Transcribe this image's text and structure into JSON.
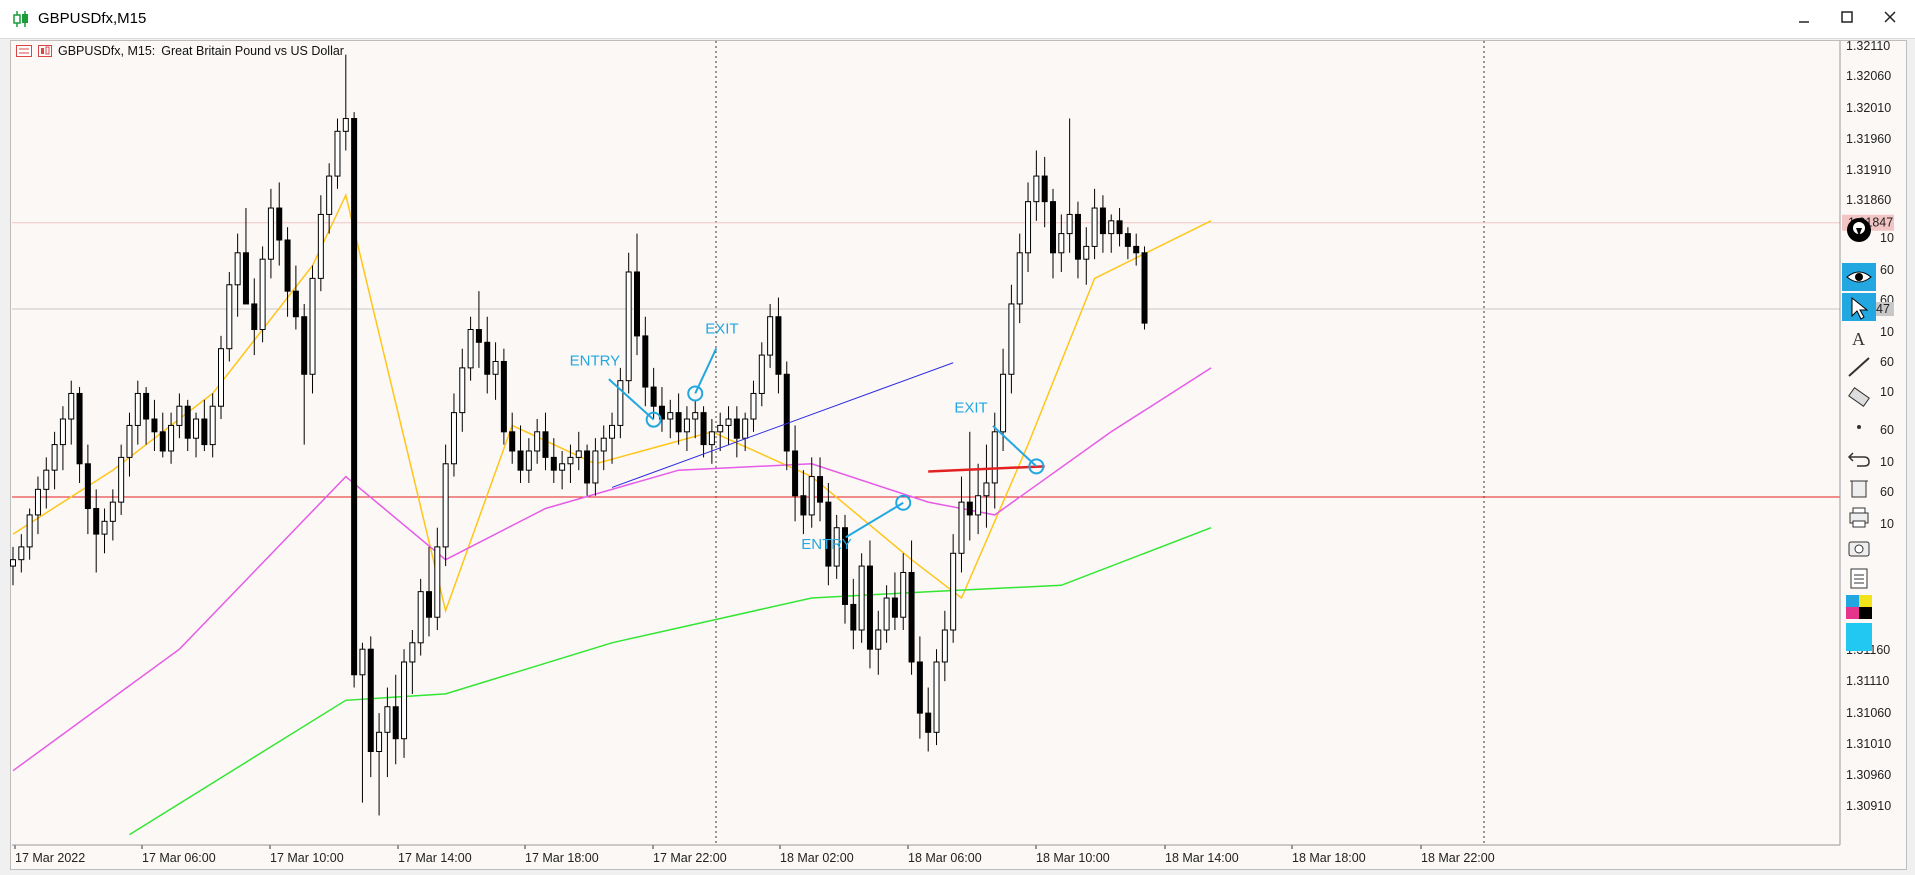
{
  "window": {
    "title": "GBPUSDfx,M15"
  },
  "header": {
    "symbol": "GBPUSDfx, M15:",
    "description": "Great Britain Pound vs US Dollar"
  },
  "colors": {
    "background": "#fbf8f6",
    "candle": "#000000",
    "ma_fast": "#ffc61a",
    "ma_mid": "#e65ce6",
    "ma_slow": "#33e633",
    "trendline": "#2d2de0",
    "level_line": "#e22222",
    "annotation": "#22a7e0"
  },
  "y_axis": {
    "labels": [
      "1.32110",
      "1.32060",
      "1.32010",
      "1.31960",
      "1.31910",
      "1.31860",
      "1.31160",
      "1.31110",
      "1.31060",
      "1.31010",
      "1.30960",
      "1.30910"
    ],
    "covered_labels": [
      "10",
      "60",
      "60",
      "10",
      "60",
      "10",
      "60",
      "10",
      "60",
      "10"
    ],
    "current_price_tag": "1.31847",
    "bid_tag": "47"
  },
  "x_axis": {
    "labels": [
      "17 Mar 2022",
      "17 Mar 06:00",
      "17 Mar 10:00",
      "17 Mar 14:00",
      "17 Mar 18:00",
      "17 Mar 22:00",
      "18 Mar 02:00",
      "18 Mar 06:00",
      "18 Mar 10:00",
      "18 Mar 14:00",
      "18 Mar 18:00",
      "18 Mar 22:00"
    ]
  },
  "annotations": {
    "entry1": "ENTRY",
    "exit1": "EXIT",
    "entry2": "ENTRY",
    "exit2": "EXIT"
  },
  "toolbar": {
    "tools": [
      "pin-tool",
      "eye-tool",
      "cursor-tool",
      "text-tool",
      "line-tool",
      "ruler-tool",
      "dot-tool",
      "undo-tool",
      "delete-tool",
      "print-tool",
      "screenshot-tool",
      "clipboard-tool",
      "color-tool",
      "color-swatch"
    ]
  },
  "chart_data": {
    "type": "candlestick",
    "symbol": "GBPUSDfx",
    "timeframe": "M15",
    "y_range": [
      1.3088,
      1.32125
    ],
    "candles": [
      [
        1.3131,
        1.3134,
        1.3128,
        1.3132
      ],
      [
        1.3132,
        1.3136,
        1.313,
        1.3134
      ],
      [
        1.3134,
        1.314,
        1.3132,
        1.3139
      ],
      [
        1.3139,
        1.3145,
        1.3136,
        1.3143
      ],
      [
        1.3143,
        1.3148,
        1.314,
        1.3146
      ],
      [
        1.3146,
        1.3152,
        1.3143,
        1.315
      ],
      [
        1.315,
        1.3156,
        1.3146,
        1.3154
      ],
      [
        1.3154,
        1.316,
        1.315,
        1.3158
      ],
      [
        1.3158,
        1.3159,
        1.3144,
        1.3147
      ],
      [
        1.3147,
        1.315,
        1.3136,
        1.314
      ],
      [
        1.314,
        1.3143,
        1.313,
        1.3136
      ],
      [
        1.3136,
        1.314,
        1.3133,
        1.3138
      ],
      [
        1.3138,
        1.3143,
        1.3135,
        1.3141
      ],
      [
        1.3141,
        1.315,
        1.3139,
        1.3148
      ],
      [
        1.3148,
        1.3155,
        1.3145,
        1.3153
      ],
      [
        1.3153,
        1.316,
        1.315,
        1.3158
      ],
      [
        1.3158,
        1.3159,
        1.315,
        1.3154
      ],
      [
        1.3154,
        1.3157,
        1.3149,
        1.3152
      ],
      [
        1.3152,
        1.3155,
        1.3148,
        1.3149
      ],
      [
        1.3149,
        1.3155,
        1.3147,
        1.3153
      ],
      [
        1.3153,
        1.3158,
        1.3151,
        1.3156
      ],
      [
        1.3156,
        1.3157,
        1.3149,
        1.3151
      ],
      [
        1.3151,
        1.3155,
        1.3148,
        1.3154
      ],
      [
        1.3154,
        1.3157,
        1.3149,
        1.315
      ],
      [
        1.315,
        1.3158,
        1.3148,
        1.3156
      ],
      [
        1.3156,
        1.3167,
        1.3154,
        1.3165
      ],
      [
        1.3165,
        1.3177,
        1.3163,
        1.3175
      ],
      [
        1.3175,
        1.3183,
        1.317,
        1.318
      ],
      [
        1.318,
        1.3187,
        1.3176,
        1.3172
      ],
      [
        1.3172,
        1.3176,
        1.3164,
        1.3168
      ],
      [
        1.3168,
        1.3181,
        1.3166,
        1.3179
      ],
      [
        1.3179,
        1.319,
        1.3176,
        1.3187
      ],
      [
        1.3187,
        1.3191,
        1.3178,
        1.3182
      ],
      [
        1.3182,
        1.3184,
        1.317,
        1.3174
      ],
      [
        1.3174,
        1.3178,
        1.3168,
        1.317
      ],
      [
        1.317,
        1.3172,
        1.315,
        1.3161
      ],
      [
        1.3161,
        1.3178,
        1.3158,
        1.3176
      ],
      [
        1.3176,
        1.3189,
        1.3174,
        1.3186
      ],
      [
        1.3186,
        1.3194,
        1.3183,
        1.3192
      ],
      [
        1.3192,
        1.3201,
        1.319,
        1.3199
      ],
      [
        1.3199,
        1.3211,
        1.3196,
        1.3201
      ],
      [
        1.3201,
        1.3202,
        1.3112,
        1.3114
      ],
      [
        1.3114,
        1.3119,
        1.3094,
        1.3118
      ],
      [
        1.3118,
        1.312,
        1.3098,
        1.3102
      ],
      [
        1.3102,
        1.3108,
        1.3092,
        1.3105
      ],
      [
        1.3105,
        1.3112,
        1.3098,
        1.3109
      ],
      [
        1.3109,
        1.3114,
        1.31,
        1.3104
      ],
      [
        1.3104,
        1.3118,
        1.3101,
        1.3116
      ],
      [
        1.3116,
        1.3121,
        1.3111,
        1.3119
      ],
      [
        1.3119,
        1.3129,
        1.3117,
        1.3127
      ],
      [
        1.3127,
        1.3134,
        1.312,
        1.3123
      ],
      [
        1.3123,
        1.3137,
        1.3121,
        1.3134
      ],
      [
        1.3134,
        1.315,
        1.3131,
        1.3147
      ],
      [
        1.3147,
        1.3158,
        1.3145,
        1.3155
      ],
      [
        1.3155,
        1.3165,
        1.3152,
        1.3162
      ],
      [
        1.3162,
        1.317,
        1.316,
        1.3168
      ],
      [
        1.3168,
        1.3174,
        1.3162,
        1.3166
      ],
      [
        1.3166,
        1.317,
        1.3158,
        1.3161
      ],
      [
        1.3161,
        1.3166,
        1.3157,
        1.3163
      ],
      [
        1.3163,
        1.3165,
        1.315,
        1.3152
      ],
      [
        1.3152,
        1.3155,
        1.3147,
        1.3149
      ],
      [
        1.3149,
        1.3153,
        1.3144,
        1.3146
      ],
      [
        1.3146,
        1.3151,
        1.3144,
        1.3149
      ],
      [
        1.3149,
        1.3154,
        1.3147,
        1.3152
      ],
      [
        1.3152,
        1.3155,
        1.3146,
        1.3148
      ],
      [
        1.3148,
        1.3151,
        1.3144,
        1.3146
      ],
      [
        1.3146,
        1.3149,
        1.3143,
        1.3147
      ],
      [
        1.3147,
        1.315,
        1.3144,
        1.3148
      ],
      [
        1.3148,
        1.3152,
        1.3146,
        1.3149
      ],
      [
        1.3149,
        1.315,
        1.3142,
        1.3144
      ],
      [
        1.3144,
        1.3151,
        1.3142,
        1.3149
      ],
      [
        1.3149,
        1.3153,
        1.3146,
        1.3151
      ],
      [
        1.3151,
        1.3155,
        1.3147,
        1.3153
      ],
      [
        1.3153,
        1.3162,
        1.3151,
        1.316
      ],
      [
        1.316,
        1.318,
        1.3158,
        1.3177
      ],
      [
        1.3177,
        1.3183,
        1.3164,
        1.3167
      ],
      [
        1.3167,
        1.317,
        1.3156,
        1.3159
      ],
      [
        1.3159,
        1.3162,
        1.3154,
        1.3156
      ],
      [
        1.3156,
        1.3159,
        1.3152,
        1.3154
      ],
      [
        1.3154,
        1.3157,
        1.3151,
        1.3155
      ],
      [
        1.3155,
        1.3158,
        1.315,
        1.3152
      ],
      [
        1.3152,
        1.3156,
        1.3149,
        1.3154
      ],
      [
        1.3154,
        1.3157,
        1.3151,
        1.3155
      ],
      [
        1.3155,
        1.3156,
        1.3148,
        1.315
      ],
      [
        1.315,
        1.3154,
        1.3147,
        1.3152
      ],
      [
        1.3152,
        1.3155,
        1.3149,
        1.3153
      ],
      [
        1.3153,
        1.3156,
        1.315,
        1.3154
      ],
      [
        1.3154,
        1.3156,
        1.3148,
        1.3151
      ],
      [
        1.3151,
        1.3155,
        1.3149,
        1.3154
      ],
      [
        1.3154,
        1.316,
        1.3152,
        1.3158
      ],
      [
        1.3158,
        1.3166,
        1.3156,
        1.3164
      ],
      [
        1.3164,
        1.3172,
        1.3162,
        1.317
      ],
      [
        1.317,
        1.3173,
        1.3158,
        1.3161
      ],
      [
        1.3161,
        1.3163,
        1.3146,
        1.3149
      ],
      [
        1.3149,
        1.3153,
        1.3138,
        1.3142
      ],
      [
        1.3142,
        1.3146,
        1.3136,
        1.3139
      ],
      [
        1.3139,
        1.3148,
        1.3137,
        1.3145
      ],
      [
        1.3145,
        1.3148,
        1.3138,
        1.3141
      ],
      [
        1.3141,
        1.3144,
        1.3128,
        1.3131
      ],
      [
        1.3131,
        1.3139,
        1.3129,
        1.3137
      ],
      [
        1.3137,
        1.3139,
        1.3122,
        1.3125
      ],
      [
        1.3125,
        1.3129,
        1.3118,
        1.3121
      ],
      [
        1.3121,
        1.3133,
        1.3119,
        1.3131
      ],
      [
        1.3131,
        1.3135,
        1.3115,
        1.3118
      ],
      [
        1.3118,
        1.3124,
        1.3114,
        1.3121
      ],
      [
        1.3121,
        1.3128,
        1.3119,
        1.3126
      ],
      [
        1.3126,
        1.313,
        1.3121,
        1.3123
      ],
      [
        1.3123,
        1.3133,
        1.3121,
        1.313
      ],
      [
        1.313,
        1.3135,
        1.3114,
        1.3116
      ],
      [
        1.3116,
        1.312,
        1.3104,
        1.3108
      ],
      [
        1.3108,
        1.3112,
        1.3102,
        1.3105
      ],
      [
        1.3105,
        1.3118,
        1.3103,
        1.3116
      ],
      [
        1.3116,
        1.3124,
        1.3113,
        1.3121
      ],
      [
        1.3121,
        1.3136,
        1.3119,
        1.3133
      ],
      [
        1.3133,
        1.3145,
        1.313,
        1.3141
      ],
      [
        1.3141,
        1.3152,
        1.3135,
        1.3139
      ],
      [
        1.3139,
        1.3147,
        1.3136,
        1.3142
      ],
      [
        1.3142,
        1.315,
        1.3137,
        1.3144
      ],
      [
        1.3144,
        1.3155,
        1.314,
        1.3152
      ],
      [
        1.3152,
        1.3165,
        1.3149,
        1.3161
      ],
      [
        1.3161,
        1.3175,
        1.3158,
        1.3172
      ],
      [
        1.3172,
        1.3183,
        1.3169,
        1.318
      ],
      [
        1.318,
        1.3191,
        1.3177,
        1.3188
      ],
      [
        1.3188,
        1.3196,
        1.3185,
        1.3192
      ],
      [
        1.3192,
        1.3195,
        1.3184,
        1.3188
      ],
      [
        1.3188,
        1.319,
        1.3176,
        1.318
      ],
      [
        1.318,
        1.3186,
        1.3177,
        1.3183
      ],
      [
        1.3183,
        1.3201,
        1.318,
        1.3186
      ],
      [
        1.3186,
        1.3188,
        1.3176,
        1.3179
      ],
      [
        1.3179,
        1.3184,
        1.3175,
        1.3181
      ],
      [
        1.3181,
        1.319,
        1.3179,
        1.3187
      ],
      [
        1.3187,
        1.3189,
        1.318,
        1.3183
      ],
      [
        1.3183,
        1.3186,
        1.318,
        1.3185
      ],
      [
        1.3185,
        1.3187,
        1.3181,
        1.3183
      ],
      [
        1.3183,
        1.3184,
        1.3179,
        1.3181
      ],
      [
        1.3181,
        1.3183,
        1.3178,
        1.318
      ],
      [
        1.318,
        1.3181,
        1.3168,
        1.3169
      ]
    ],
    "moving_averages": [
      {
        "color_key": "ma_fast",
        "values": [
          [
            0,
            1.3136
          ],
          [
            12,
            1.3146
          ],
          [
            24,
            1.3158
          ],
          [
            36,
            1.3178
          ],
          [
            40,
            1.3189
          ],
          [
            52,
            1.3124
          ],
          [
            60,
            1.3153
          ],
          [
            70,
            1.3147
          ],
          [
            84,
            1.3152
          ],
          [
            96,
            1.3145
          ],
          [
            108,
            1.3132
          ],
          [
            114,
            1.3126
          ],
          [
            122,
            1.315
          ],
          [
            130,
            1.3176
          ],
          [
            144,
            1.3185
          ]
        ]
      },
      {
        "color_key": "ma_mid",
        "values": [
          [
            0,
            1.3099
          ],
          [
            20,
            1.3118
          ],
          [
            40,
            1.3145
          ],
          [
            52,
            1.3132
          ],
          [
            64,
            1.314
          ],
          [
            80,
            1.3146
          ],
          [
            96,
            1.3147
          ],
          [
            110,
            1.3141
          ],
          [
            118,
            1.3139
          ],
          [
            132,
            1.3152
          ],
          [
            144,
            1.3162
          ]
        ]
      },
      {
        "color_key": "ma_slow",
        "values": [
          [
            14,
            1.3089
          ],
          [
            40,
            1.311
          ],
          [
            52,
            1.3111
          ],
          [
            72,
            1.3119
          ],
          [
            96,
            1.3126
          ],
          [
            110,
            1.3127
          ],
          [
            126,
            1.3128
          ],
          [
            144,
            1.3137
          ]
        ]
      }
    ],
    "horizontal_lines": [
      {
        "price": 1.31847,
        "color": "#f3c4c4"
      },
      {
        "price": 1.31712,
        "color": "#c8c8c8"
      },
      {
        "price": 1.31418,
        "color": "#e22222"
      }
    ],
    "trades": [
      {
        "label": "ENTRY",
        "candle": 77,
        "price": 1.31539
      },
      {
        "label": "EXIT",
        "candle": 82,
        "price": 1.3158
      },
      {
        "label": "ENTRY",
        "candle": 107,
        "price": 1.31409
      },
      {
        "label": "EXIT",
        "candle": 123,
        "price": 1.31466
      }
    ]
  }
}
